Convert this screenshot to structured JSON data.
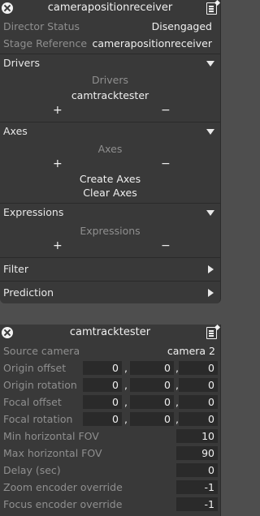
{
  "receiver": {
    "title": "camerapositionreceiver",
    "director_status_label": "Director Status",
    "director_status_value": "Disengaged",
    "stage_reference_label": "Stage Reference",
    "stage_reference_value": "camerapositionreceiver",
    "drivers": {
      "label": "Drivers",
      "header": "Drivers",
      "item": "camtracktester",
      "plus": "+",
      "minus": "−"
    },
    "axes": {
      "label": "Axes",
      "header": "Axes",
      "plus": "+",
      "minus": "−",
      "create": "Create Axes",
      "clear": "Clear Axes"
    },
    "expressions": {
      "label": "Expressions",
      "header": "Expressions",
      "plus": "+",
      "minus": "−"
    },
    "filter": {
      "label": "Filter"
    },
    "prediction": {
      "label": "Prediction"
    }
  },
  "tester": {
    "title": "camtracktester",
    "source_camera_label": "Source camera",
    "source_camera_value": "camera 2",
    "origin_offset_label": "Origin offset",
    "origin_offset": [
      "0",
      "0",
      "0"
    ],
    "origin_rotation_label": "Origin rotation",
    "origin_rotation": [
      "0",
      "0",
      "0"
    ],
    "focal_offset_label": "Focal offset",
    "focal_offset": [
      "0",
      "0",
      "0"
    ],
    "focal_rotation_label": "Focal rotation",
    "focal_rotation": [
      "0",
      "0",
      "0"
    ],
    "min_fov_label": "Min horizontal FOV",
    "min_fov": "10",
    "max_fov_label": "Max horizontal FOV",
    "max_fov": "90",
    "delay_label": "Delay (sec)",
    "delay": "0",
    "zoom_label": "Zoom encoder override",
    "zoom": "-1",
    "focus_label": "Focus encoder override",
    "focus": "-1"
  },
  "separator": ","
}
